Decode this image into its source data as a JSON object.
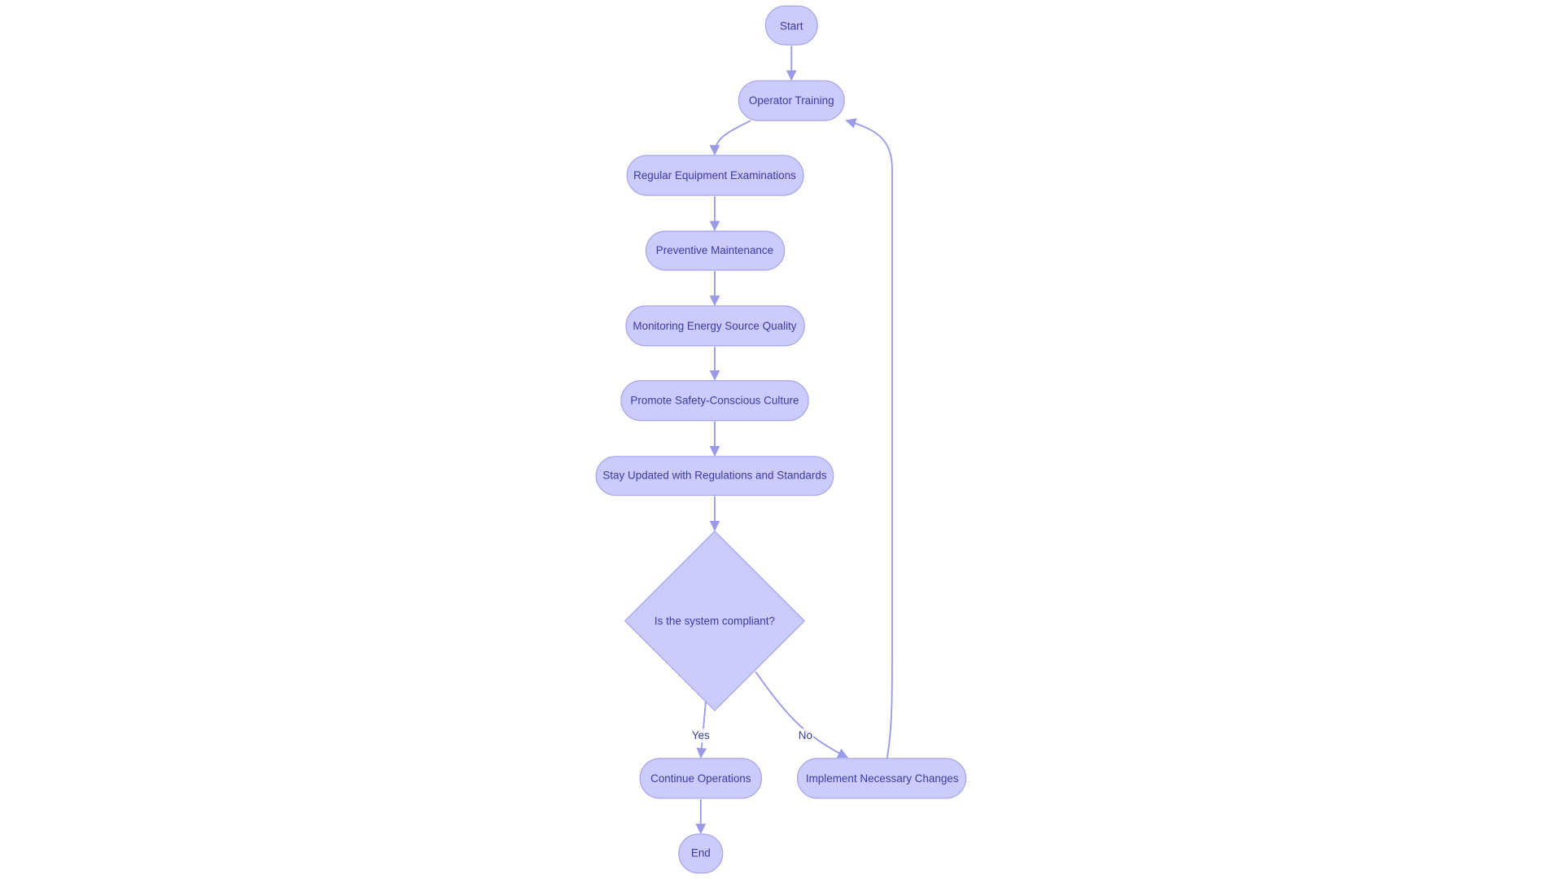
{
  "diagram": {
    "type": "flowchart",
    "colors": {
      "node_fill": "#cbcbfc",
      "node_stroke": "#a5a5ee",
      "edge": "#9a9ae8",
      "text": "#3b3ba6"
    },
    "nodes": {
      "start": "Start",
      "operator_training": "Operator Training",
      "regular_exams": "Regular Equipment Examinations",
      "preventive": "Preventive Maintenance",
      "monitoring": "Monitoring Energy Source Quality",
      "promote": "Promote Safety-Conscious Culture",
      "stay_updated": "Stay Updated with Regulations and Standards",
      "decision": "Is the system compliant?",
      "continue": "Continue Operations",
      "implement": "Implement Necessary Changes",
      "end": "End"
    },
    "edges": [
      {
        "from": "start",
        "to": "operator_training"
      },
      {
        "from": "operator_training",
        "to": "regular_exams"
      },
      {
        "from": "regular_exams",
        "to": "preventive"
      },
      {
        "from": "preventive",
        "to": "monitoring"
      },
      {
        "from": "monitoring",
        "to": "promote"
      },
      {
        "from": "promote",
        "to": "stay_updated"
      },
      {
        "from": "stay_updated",
        "to": "decision"
      },
      {
        "from": "decision",
        "to": "continue",
        "label": "Yes"
      },
      {
        "from": "decision",
        "to": "implement",
        "label": "No"
      },
      {
        "from": "continue",
        "to": "end"
      },
      {
        "from": "implement",
        "to": "operator_training"
      }
    ]
  }
}
